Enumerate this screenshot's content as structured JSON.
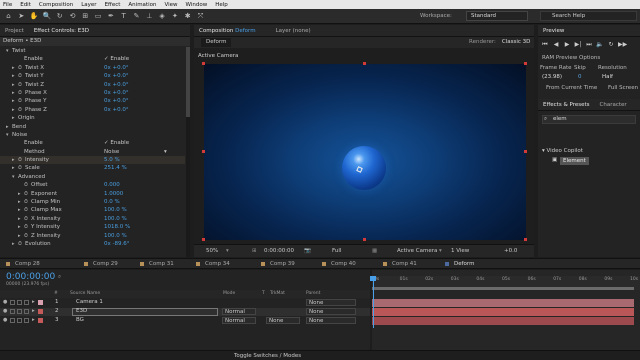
{
  "menu": [
    "File",
    "Edit",
    "Composition",
    "Layer",
    "Effect",
    "Animation",
    "View",
    "Window",
    "Help"
  ],
  "toolbar": {
    "tools": [
      {
        "icon": "home-icon",
        "glyph": "⌂"
      },
      {
        "icon": "selection-icon",
        "glyph": "➤"
      },
      {
        "icon": "hand-icon",
        "glyph": "✋"
      },
      {
        "icon": "zoom-icon",
        "glyph": "🔍"
      },
      {
        "icon": "rotate-icon",
        "glyph": "↻"
      },
      {
        "icon": "camera-orbit-icon",
        "glyph": "⟲"
      },
      {
        "icon": "pan-behind-icon",
        "glyph": "⊞"
      },
      {
        "icon": "mask-rect-icon",
        "glyph": "▭"
      },
      {
        "icon": "pen-icon",
        "glyph": "✒"
      },
      {
        "icon": "type-icon",
        "glyph": "T"
      },
      {
        "icon": "brush-icon",
        "glyph": "✎"
      },
      {
        "icon": "clone-icon",
        "glyph": "⊥"
      },
      {
        "icon": "eraser-icon",
        "glyph": "◈"
      },
      {
        "icon": "roto-icon",
        "glyph": "✦"
      },
      {
        "icon": "puppet-icon",
        "glyph": "✱"
      },
      {
        "icon": "axis-icon",
        "glyph": "⤧"
      }
    ],
    "workspace_label": "Workspace:",
    "workspace_value": "Standard",
    "search_help": "Search Help"
  },
  "left_panel": {
    "tabs": [
      "Project",
      "Effect Controls: E3D"
    ],
    "header": "Deform • E3D",
    "rows": [
      {
        "indent": 1,
        "arrow": "▾",
        "label": "Twist",
        "value": "",
        "hl": false
      },
      {
        "indent": 3,
        "arrow": "",
        "label": "Enable",
        "value": "✓ Enable",
        "plain": true,
        "hl": false
      },
      {
        "indent": 2,
        "arrow": "▸",
        "label": "Twist X",
        "value": "0x +0.0°",
        "sw": true,
        "hl": false
      },
      {
        "indent": 2,
        "arrow": "▸",
        "label": "Twist Y",
        "value": "0x +0.0°",
        "sw": true,
        "hl": false
      },
      {
        "indent": 2,
        "arrow": "▸",
        "label": "Twist Z",
        "value": "0x +0.0°",
        "sw": true,
        "hl": false
      },
      {
        "indent": 2,
        "arrow": "▸",
        "label": "Phase X",
        "value": "0x +0.0°",
        "sw": true,
        "hl": false
      },
      {
        "indent": 2,
        "arrow": "▸",
        "label": "Phase Y",
        "value": "0x +0.0°",
        "sw": true,
        "hl": false
      },
      {
        "indent": 2,
        "arrow": "▸",
        "label": "Phase Z",
        "value": "0x +0.0°",
        "sw": true,
        "hl": false
      },
      {
        "indent": 2,
        "arrow": "▸",
        "label": "Origin",
        "value": "",
        "hl": false
      },
      {
        "indent": 1,
        "arrow": "▸",
        "label": "Bend",
        "value": "",
        "hl": false
      },
      {
        "indent": 1,
        "arrow": "▾",
        "label": "Noise",
        "value": "",
        "hl": false
      },
      {
        "indent": 3,
        "arrow": "",
        "label": "Enable",
        "value": "✓ Enable",
        "plain": true,
        "hl": false
      },
      {
        "indent": 3,
        "arrow": "",
        "label": "Method",
        "value": "Noise",
        "plain": true,
        "dropdown": true,
        "hl": false
      },
      {
        "indent": 2,
        "arrow": "▸",
        "label": "Intensity",
        "value": "5.0 %",
        "sw": true,
        "hl": true
      },
      {
        "indent": 2,
        "arrow": "▸",
        "label": "Scale",
        "value": "251.4 %",
        "sw": true,
        "hl": false
      },
      {
        "indent": 2,
        "arrow": "▾",
        "label": "Advanced",
        "value": "",
        "hl": false
      },
      {
        "indent": 3,
        "arrow": "",
        "label": "Offset",
        "value": "0.000",
        "sw": true,
        "hl": false
      },
      {
        "indent": 3,
        "arrow": "▸",
        "label": "Exponent",
        "value": "1.0000",
        "sw": true,
        "hl": false
      },
      {
        "indent": 3,
        "arrow": "▸",
        "label": "Clamp Min",
        "value": "0.0 %",
        "sw": true,
        "hl": false
      },
      {
        "indent": 3,
        "arrow": "▸",
        "label": "Clamp Max",
        "value": "100.0 %",
        "sw": true,
        "hl": false
      },
      {
        "indent": 3,
        "arrow": "▸",
        "label": "X Intensity",
        "value": "100.0 %",
        "sw": true,
        "hl": false
      },
      {
        "indent": 3,
        "arrow": "▸",
        "label": "Y Intensity",
        "value": "1018.0 %",
        "sw": true,
        "hl": false
      },
      {
        "indent": 3,
        "arrow": "▸",
        "label": "Z Intensity",
        "value": "100.0 %",
        "sw": true,
        "hl": false
      },
      {
        "indent": 2,
        "arrow": "▸",
        "label": "Evolution",
        "value": "0x -89.6°",
        "sw": true,
        "hl": false
      }
    ]
  },
  "comp_panel": {
    "tab_label": "Composition",
    "tab_comp": "Deform",
    "layer_tab": "Layer (none)",
    "sub_tab": "Deform",
    "renderer_label": "Renderer:",
    "renderer_value": "Classic 3D",
    "view_label": "Active Camera",
    "footer": {
      "zoom": "50%",
      "timecode": "0:00:00:00",
      "resolution": "Full",
      "camera": "Active Camera",
      "views": "1 View",
      "exposure": "+0.0"
    }
  },
  "right_panel": {
    "preview_tab": "Preview",
    "ram_options": "RAM Preview Options",
    "frame_rate_label": "Frame Rate",
    "skip_label": "Skip",
    "resolution_label": "Resolution",
    "frame_rate_value": "(23.98)",
    "skip_value": "0",
    "resolution_value": "Half",
    "from_current": "From Current Time",
    "full_screen": "Full Screen",
    "fx_tab": "Effects & Presets",
    "char_tab": "Character",
    "search_text": "elem",
    "category": "Video Copilot",
    "effect": "Element"
  },
  "timeline": {
    "tabs": [
      "Comp 28",
      "Comp 29",
      "Comp 31",
      "Comp 34",
      "Comp 39",
      "Comp 40",
      "Comp 41",
      "Deform"
    ],
    "active_tab": "Deform",
    "timecode": "0:00:00:00",
    "frames": "00000 (23.976 fps)",
    "columns": [
      "#",
      "Source Name",
      "Mode",
      "T",
      "TrkMat",
      "Parent"
    ],
    "layers": [
      {
        "num": "1",
        "name": "Camera 1",
        "mode": "",
        "trkmat": "",
        "parent": "None",
        "color": "#d9a0b0",
        "bar": "#a86a70"
      },
      {
        "num": "2",
        "name": "E3D",
        "mode": "Normal",
        "trkmat": "",
        "parent": "None",
        "color": "#c45a5a",
        "bar": "#b85658",
        "selected": true
      },
      {
        "num": "3",
        "name": "BG",
        "mode": "Normal",
        "trkmat": "None",
        "parent": "None",
        "color": "#c45a5a",
        "bar": "#9c4a4d"
      }
    ],
    "ruler": [
      "0s",
      "01s",
      "02s",
      "03s",
      "04s",
      "05s",
      "06s",
      "07s",
      "08s",
      "09s",
      "10s"
    ],
    "toggle_label": "Toggle Switches / Modes"
  }
}
